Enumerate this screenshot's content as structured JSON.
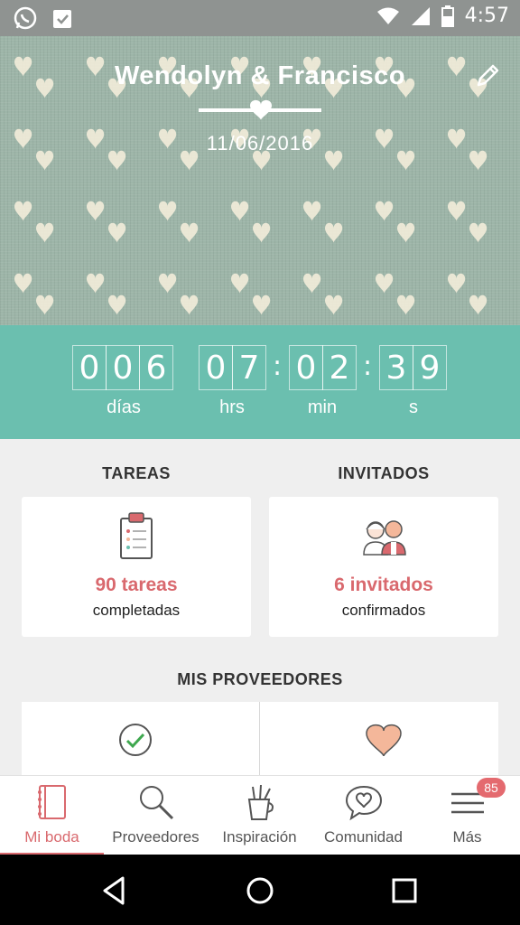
{
  "status_bar": {
    "time": "4:57",
    "icons": [
      "whatsapp-icon",
      "clipboard-check-icon",
      "wifi-icon",
      "signal-icon",
      "battery-icon"
    ]
  },
  "hero": {
    "couple": "Wendolyn & Francisco",
    "date": "11/06/2016"
  },
  "countdown": {
    "days": [
      "0",
      "0",
      "6"
    ],
    "hours": [
      "0",
      "7"
    ],
    "minutes": [
      "0",
      "2"
    ],
    "seconds": [
      "3",
      "9"
    ],
    "separator": ":",
    "labels": {
      "days": "días",
      "hours": "hrs",
      "minutes": "min",
      "seconds": "s"
    }
  },
  "tasks": {
    "title": "TAREAS",
    "count": "90 tareas",
    "status": "completadas"
  },
  "guests": {
    "title": "INVITADOS",
    "count": "6 invitados",
    "status": "confirmados"
  },
  "vendors": {
    "title": "MIS PROVEEDORES"
  },
  "bottom_nav": {
    "items": [
      {
        "label": "Mi boda",
        "icon": "notebook-icon"
      },
      {
        "label": "Proveedores",
        "icon": "search-icon"
      },
      {
        "label": "Inspiración",
        "icon": "pencil-cup-icon"
      },
      {
        "label": "Comunidad",
        "icon": "chat-heart-icon"
      },
      {
        "label": "Más",
        "icon": "menu-icon"
      }
    ],
    "badge": "85"
  },
  "colors": {
    "teal": "#6bbfaf",
    "accent": "#d9696e",
    "heart_peach": "#f4b79a"
  }
}
